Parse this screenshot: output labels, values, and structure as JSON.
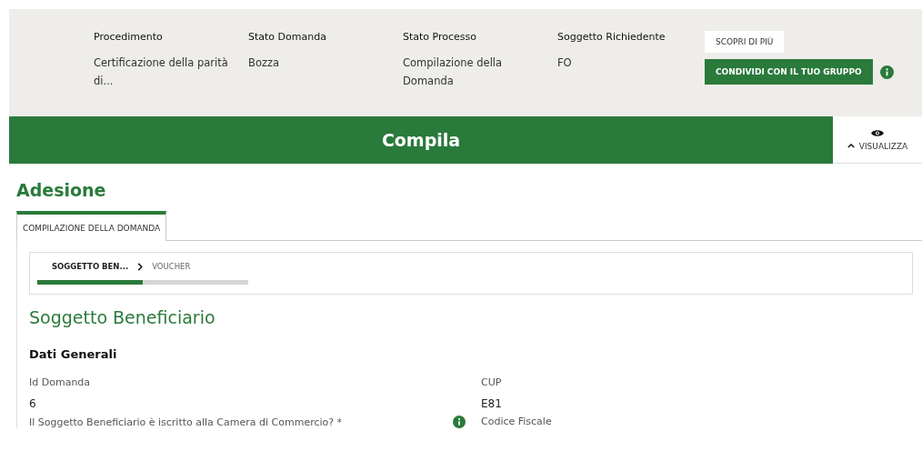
{
  "summary": [
    {
      "label": "Procedimento",
      "value": "Certificazione della parità di..."
    },
    {
      "label": "Stato Domanda",
      "value": "Bozza"
    },
    {
      "label": "Stato Processo",
      "value": "Compilazione della Domanda"
    },
    {
      "label": "Soggetto Richiedente",
      "value": "FO"
    }
  ],
  "actions": {
    "more": "SCOPRI DI PIÙ",
    "share": "CONDIVIDI CON IL TUO GRUPPO"
  },
  "banner": {
    "title": "Compila",
    "toggle": "VISUALIZZA",
    "expanded": true
  },
  "page_title": "Adesione",
  "tabs": [
    {
      "label": "COMPILAZIONE DELLA DOMANDA",
      "selected": true
    }
  ],
  "steps": [
    {
      "label": "SOGGETTO BEN...",
      "selected": true
    },
    {
      "label": "VOUCHER",
      "selected": false
    }
  ],
  "progress": {
    "level": 0.5
  },
  "section_title": "Soggetto Beneficiario",
  "subsection_title": "Dati Generali",
  "fields": [
    {
      "label": "Id Domanda",
      "value": "6",
      "info": false
    },
    {
      "label": "CUP",
      "value": "E81",
      "info": false
    },
    {
      "label": "Il Soggetto Beneficiario è iscritto alla Camera di Commercio? *",
      "info": true
    },
    {
      "label": "Codice Fiscale",
      "info": false
    }
  ]
}
